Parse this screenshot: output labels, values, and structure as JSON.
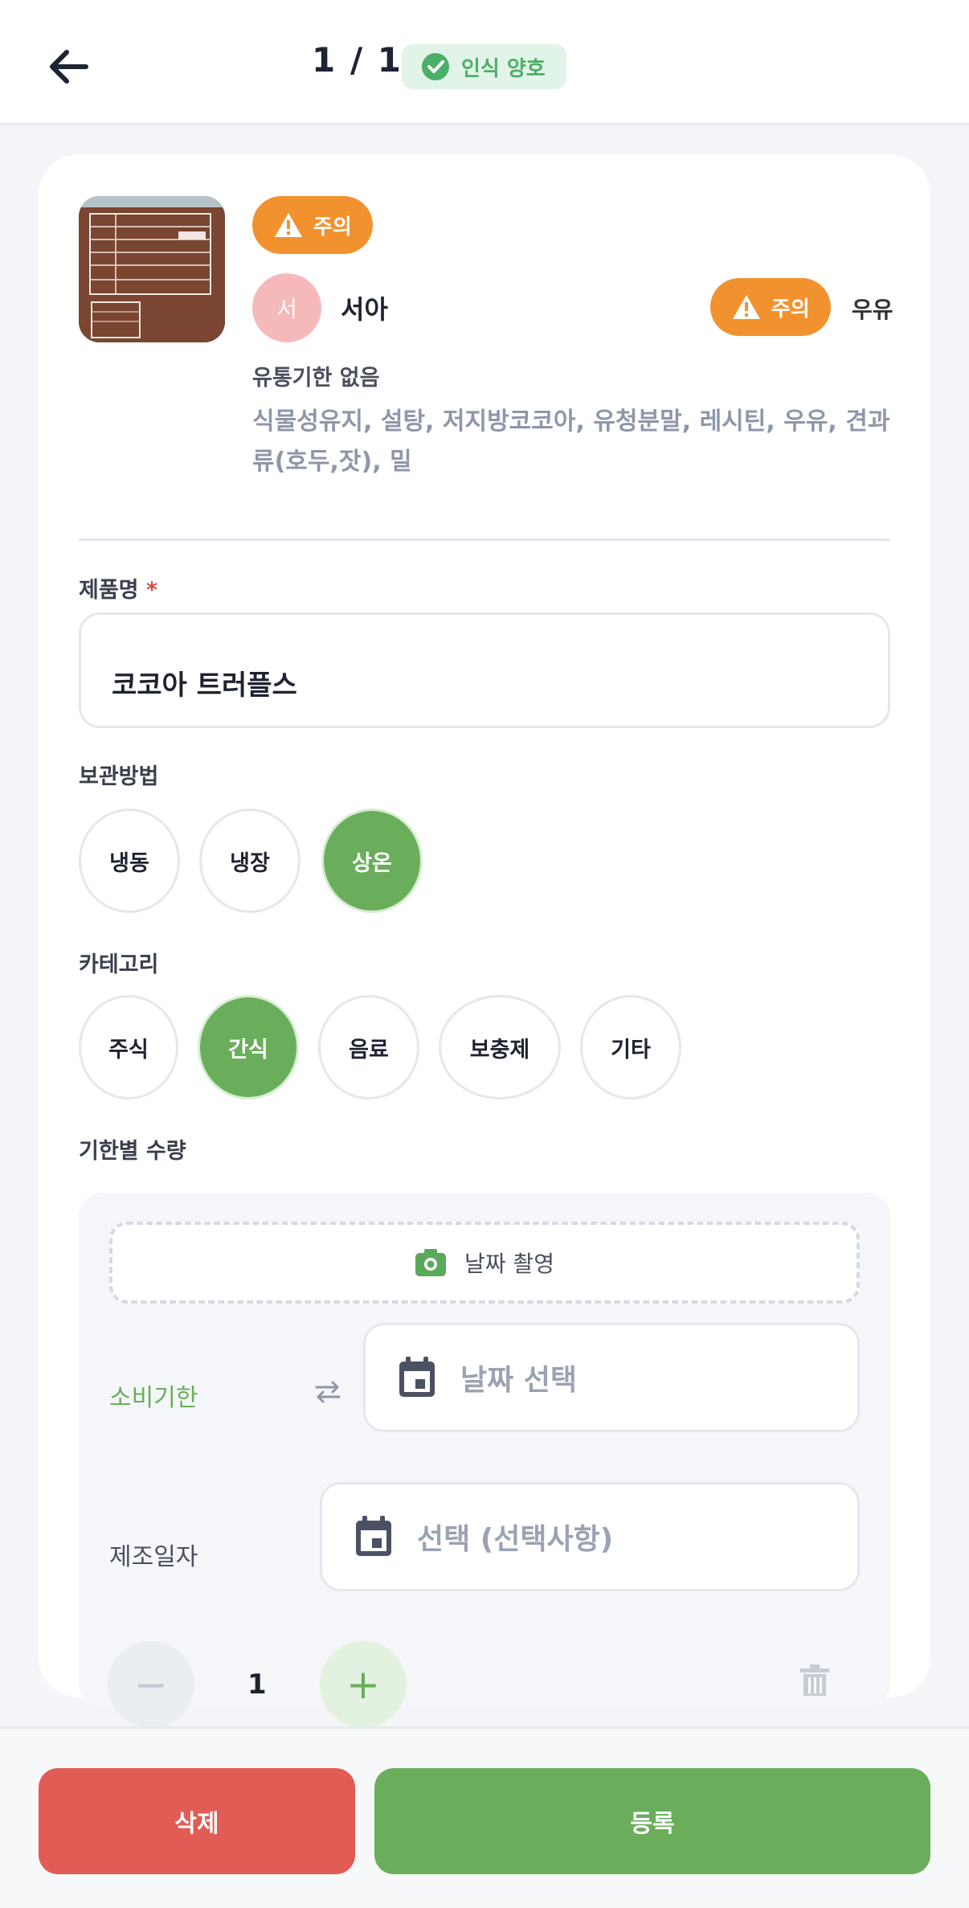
{
  "header": {
    "page_counter": "1 / 1",
    "status_label": "인식 양호"
  },
  "product": {
    "warning_label": "주의",
    "person_initial": "서",
    "person_name": "서아",
    "person_warning_label": "주의",
    "allergen": "우유",
    "expiry_note": "유통기한 없음",
    "ingredients": "식물성유지, 설탕, 저지방코코아, 유청분말, 레시틴, 우유, 견과류(호두,잣), 밀"
  },
  "form": {
    "name_label": "제품명",
    "required_mark": "*",
    "name_value": "코코아 트러플스",
    "storage_label": "보관방법",
    "storage_options": [
      "냉동",
      "냉장",
      "상온"
    ],
    "storage_selected": "상온",
    "category_label": "카테고리",
    "category_options": [
      "주식",
      "간식",
      "음료",
      "보충제",
      "기타"
    ],
    "category_selected": "간식",
    "quantity_label": "기한별 수량"
  },
  "quantity_panel": {
    "photo_button_label": "날짜 촬영",
    "use_by_label": "소비기한",
    "use_by_placeholder": "날짜 선택",
    "manufactured_label": "제조일자",
    "manufactured_placeholder": "선택 (선택사항)",
    "quantity": "1",
    "minus": "−",
    "plus": "+"
  },
  "footer": {
    "delete_label": "삭제",
    "register_label": "등록"
  },
  "colors": {
    "accent_green": "#6aae5c",
    "warning_orange": "#f2922f",
    "delete_red": "#e05c55"
  }
}
